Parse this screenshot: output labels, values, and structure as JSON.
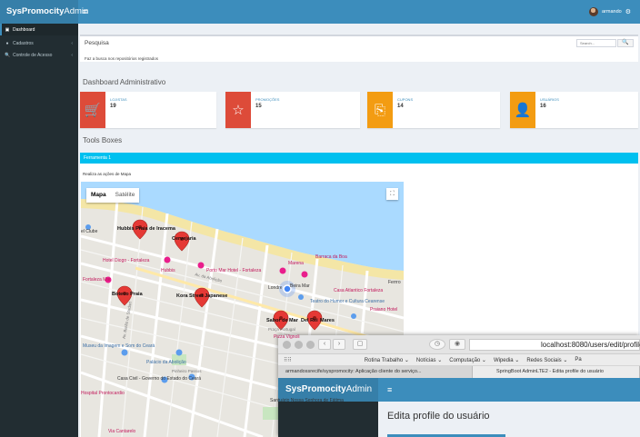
{
  "app": {
    "logo_bold": "SysPromocity",
    "logo_light": "Admin",
    "hamburger": "≡",
    "user_name": "armando",
    "gear": "⚙"
  },
  "sidebar": {
    "items": [
      {
        "icon": "▣",
        "label": "Dashboard"
      },
      {
        "icon": "●",
        "label": "Cadastros",
        "chevron": "‹"
      },
      {
        "icon": "🔍",
        "label": "Controle de Acesso",
        "chevron": "‹"
      }
    ]
  },
  "search": {
    "title": "Pesquisa",
    "placeholder": "Search...",
    "button_icon": "🔍",
    "hint": "Faz a busca nos repositórios registrados"
  },
  "dashboard": {
    "title": "Dashboard Administrativo",
    "boxes": [
      {
        "label": "LOJISTAS",
        "count": "19",
        "icon": "🛒",
        "color": "#dd4b39"
      },
      {
        "label": "PROMOÇÕES",
        "count": "15",
        "icon": "☆",
        "color": "#dd4b39"
      },
      {
        "label": "CUPONS",
        "count": "14",
        "icon": "⎘",
        "color": "#f39c12"
      },
      {
        "label": "USUÁRIOS",
        "count": "16",
        "icon": "👤",
        "color": "#f39c12"
      }
    ]
  },
  "tools": {
    "title": "Tools Boxes",
    "bar_label": "Ferramenta 1",
    "hint": "Realiza as ações de Mapa"
  },
  "map": {
    "type_map": "Mapa",
    "type_satellite": "Satélite",
    "fullscreen_icon": "⛶",
    "labels": {
      "l1": "Hubbis Praia de Iracema",
      "l2": "Cervejaria",
      "l3": "el Clube",
      "l4": "Hotel Diogo - Fortaleza",
      "l5": "Fortaleza Mar",
      "l6": "Hubbis",
      "l7": "Porto Mar Hotel - Fortaleza",
      "l8": "Boteco Praia",
      "l9": "Kora Street Japanese",
      "l10": "Londre",
      "l11": "Beira Mar",
      "l12": "Teatro do Humor e Cultura Cearense",
      "l13": "Sabor de Mar",
      "l14": "Del Rei",
      "l15": "Mares",
      "l16": "Museu da Imagem e Som do Ceará",
      "l17": "Palácio da Abolição",
      "l18": "Casa Civil - Governo do Estado do Ceará",
      "l19": "Praça Portugal",
      "l20": "Pizza Vignoli",
      "l21": "Barraca da Boa",
      "l22": "Marena",
      "l23": "Pinheiro Passos",
      "l24": "Av. da Abolição",
      "l25": "Av. Barão de Studart",
      "l26": "Hospital Prontocardio",
      "l27": "Santuário Nossa Senhora de Fátima",
      "l28": "Via Cantarelo",
      "l29": "Ferrro",
      "l30": "Casa Atlantico Fortaleza",
      "l31": "Praiano Hotel"
    }
  },
  "browser": {
    "url": "localhost:8080/users/edit/profile",
    "back": "‹",
    "forward": "›",
    "bookmarks": [
      "Rotina Trabalho ⌄",
      "Notícias ⌄",
      "Computação ⌄",
      "Wipedia ⌄",
      "Redes Sociais ⌄",
      "Pa"
    ],
    "tab1": "armandossrecife/syspromocity: Aplicação cliente do serviço...",
    "tab2": "SpringBoot AdminLTE2 - Edita profile do usuário",
    "logo_bold": "SysPromocity",
    "logo_light": "Admin",
    "hamburger": "≡",
    "page_title": "Edita profile do usuário"
  }
}
